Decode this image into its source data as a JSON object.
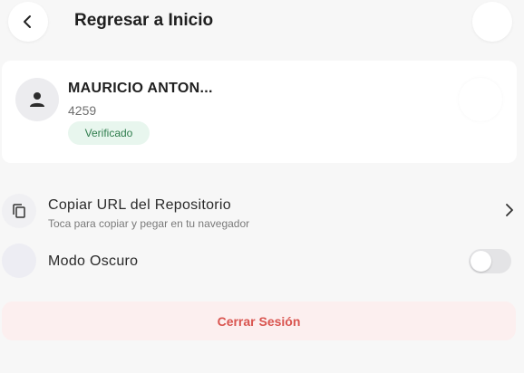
{
  "header": {
    "title": "Regresar a Inicio",
    "back_icon": "chevron-left-icon"
  },
  "profile": {
    "name": "MAURICIO ANTON...",
    "id": "4259",
    "status": "Verificado",
    "avatar_icon": "person-icon"
  },
  "settings": {
    "copy_url": {
      "title": "Copiar URL del Repositorio",
      "subtitle": "Toca para copiar y pegar en tu navegador",
      "icon": "copy-icon"
    },
    "dark_mode": {
      "title": "Modo Oscuro",
      "enabled": false,
      "icon": "moon-icon"
    }
  },
  "logout": {
    "label": "Cerrar Sesión"
  },
  "colors": {
    "background": "#f7f7f7",
    "badge_bg": "#e8f6ee",
    "badge_text": "#2f7d4d",
    "logout_bg": "#fcefef",
    "logout_text": "#d9544f"
  }
}
